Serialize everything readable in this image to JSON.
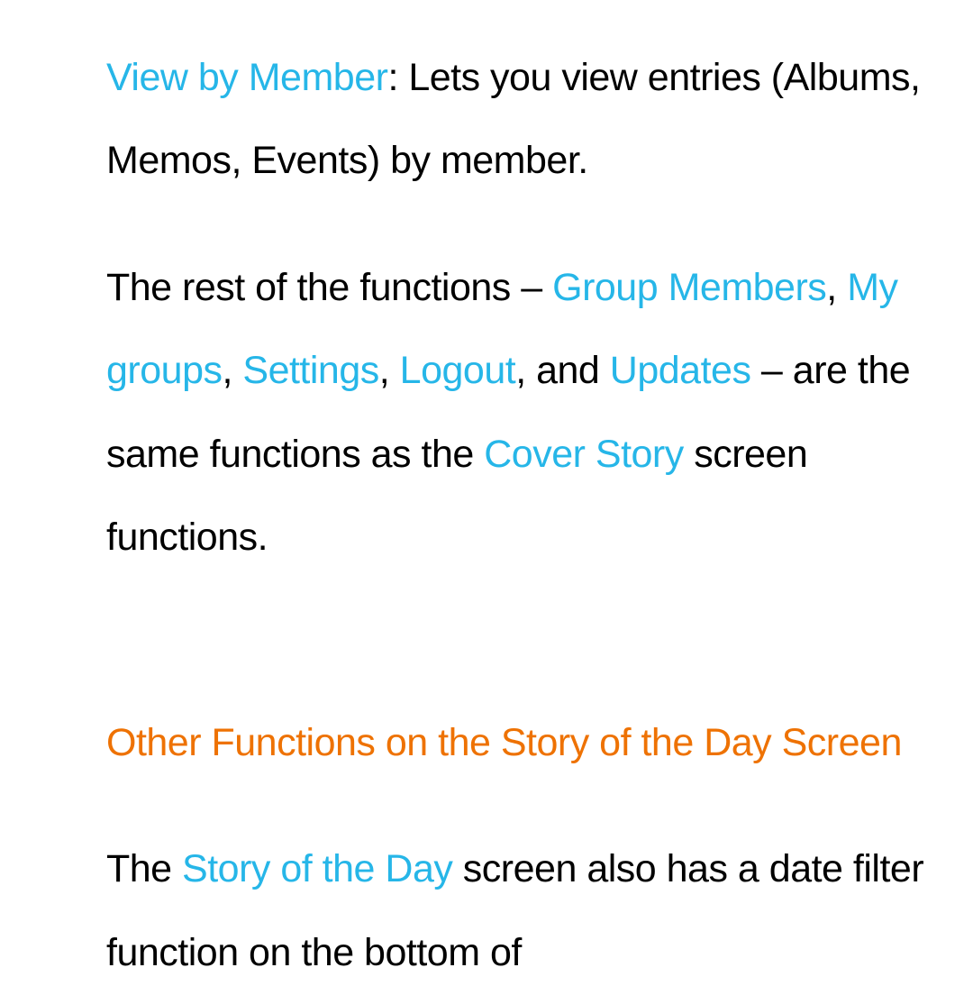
{
  "para1": {
    "link_view_by_member": "View by Member",
    "text_after": ": Lets you view entries (Albums, Memos, Events) by member."
  },
  "para2": {
    "text1": "The rest of the functions – ",
    "link_group_members": "Group Members",
    "sep1": ", ",
    "link_my_groups": "My groups",
    "sep2": ", ",
    "link_settings": "Settings",
    "sep3": ", ",
    "link_logout": "Logout",
    "sep4": ", and ",
    "link_updates": "Updates",
    "text2": " – are the same functions as the ",
    "link_cover_story": "Cover Story",
    "text3": " screen functions."
  },
  "heading": "Other Functions on the Story of the Day Screen",
  "para3": {
    "text1": "The ",
    "link_story_of_the_day": "Story of the Day",
    "text2": " screen also has a date filter function on the bottom of"
  }
}
